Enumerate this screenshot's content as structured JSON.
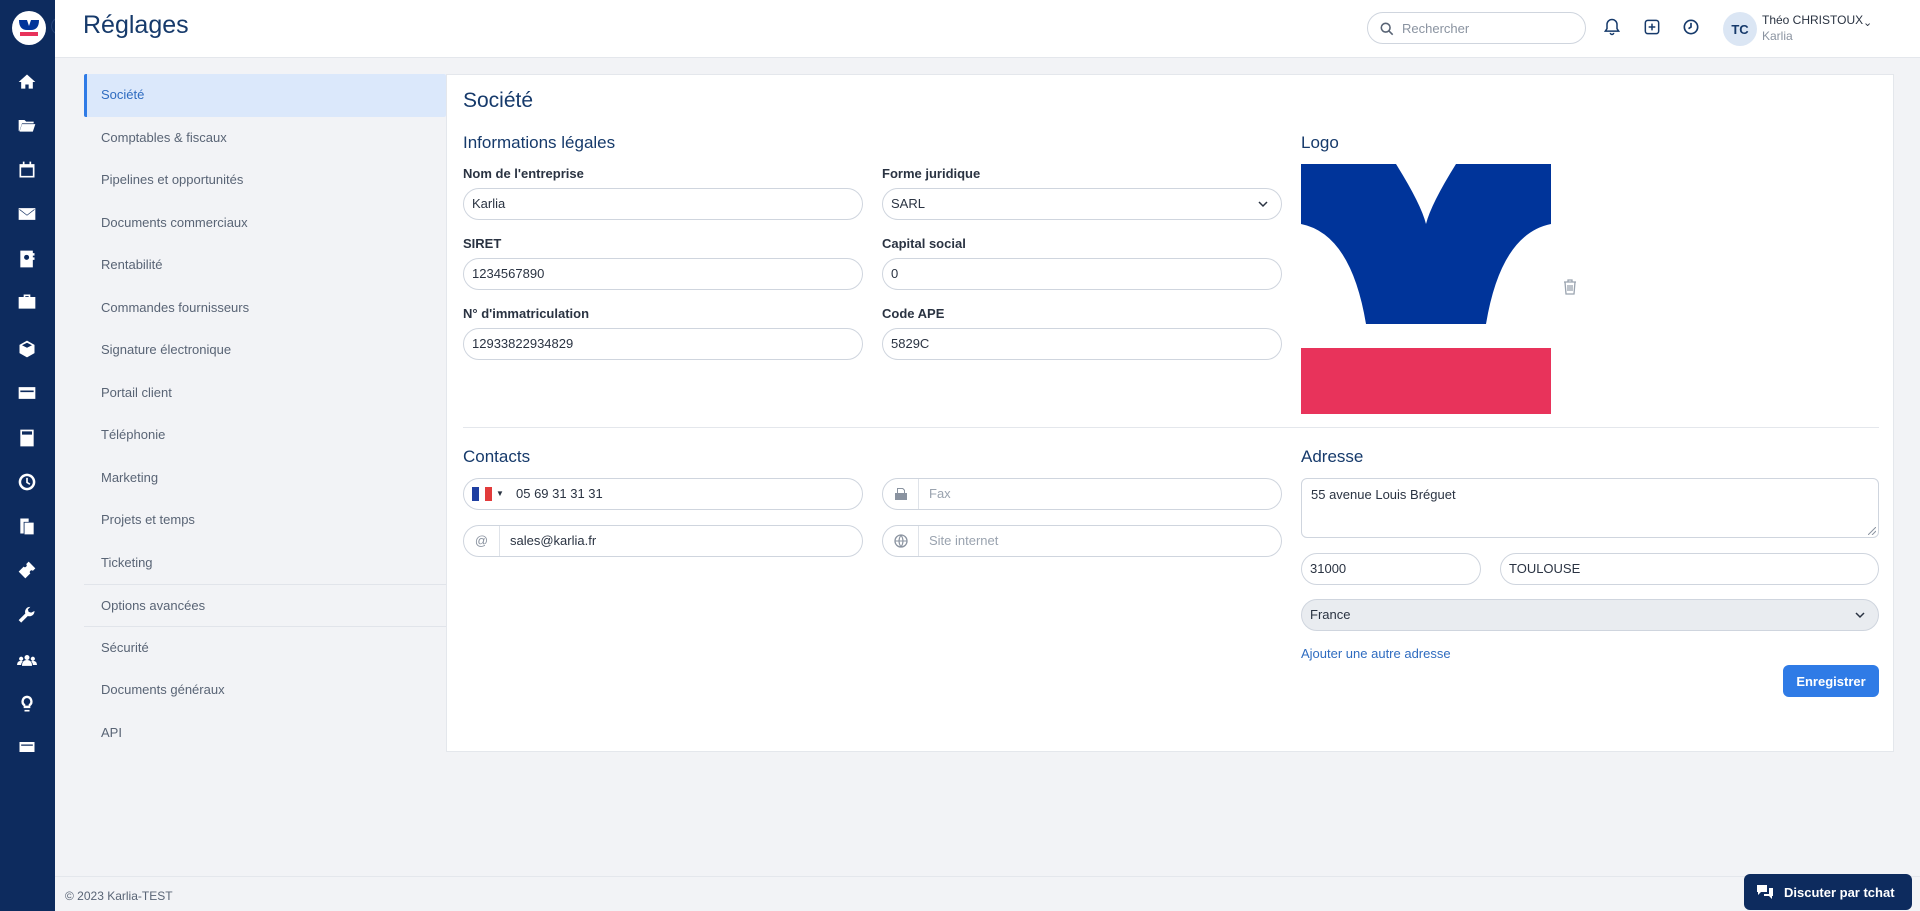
{
  "app": {
    "title": "Réglages",
    "brand_colors": {
      "primary": "#0d2b5e",
      "accent": "#2f7be6",
      "logo_blue": "#00349a",
      "logo_red": "#e8335b"
    }
  },
  "rail": {
    "icons": [
      "logo-icon",
      "home-icon",
      "folder-icon",
      "calendar-icon",
      "envelope-icon",
      "contact-card-icon",
      "briefcase-icon",
      "box-icon",
      "credit-card-icon",
      "calculator-icon",
      "clock-icon",
      "copy-icon",
      "ticket-icon",
      "wrench-icon",
      "users-icon",
      "lightbulb-icon",
      "card-icon"
    ]
  },
  "header": {
    "search_placeholder": "Rechercher",
    "user": {
      "initials": "TC",
      "name": "Théo CHRISTOUX",
      "company": "Karlia"
    },
    "help": "?"
  },
  "settings_menu": {
    "items": [
      {
        "label": "Société"
      },
      {
        "label": "Comptables & fiscaux"
      },
      {
        "label": "Pipelines et opportunités"
      },
      {
        "label": "Documents commerciaux"
      },
      {
        "label": "Rentabilité"
      },
      {
        "label": "Commandes fournisseurs"
      },
      {
        "label": "Signature électronique"
      },
      {
        "label": "Portail client"
      },
      {
        "label": "Téléphonie"
      },
      {
        "label": "Marketing"
      },
      {
        "label": "Projets et temps"
      },
      {
        "label": "Ticketing"
      },
      {
        "label": "Options avancées"
      },
      {
        "label": "Sécurité"
      },
      {
        "label": "Documents généraux"
      },
      {
        "label": "API"
      }
    ]
  },
  "panel": {
    "title": "Société",
    "legal": {
      "title": "Informations légales",
      "company_name_label": "Nom de l'entreprise",
      "company_name": "Karlia",
      "legal_form_label": "Forme juridique",
      "legal_form": "SARL",
      "siret_label": "SIRET",
      "siret": "1234567890",
      "capital_label": "Capital social",
      "capital": "0",
      "registration_label": "N° d'immatriculation",
      "registration": "12933822934829",
      "ape_label": "Code APE",
      "ape": "5829C"
    },
    "logo": {
      "title": "Logo"
    },
    "contacts": {
      "title": "Contacts",
      "phone": "05 69 31 31 31",
      "fax_placeholder": "Fax",
      "email_prefix": "@",
      "email": "sales@karlia.fr",
      "website_placeholder": "Site internet"
    },
    "address": {
      "title": "Adresse",
      "street": "55 avenue Louis Bréguet",
      "postcode": "31000",
      "city": "TOULOUSE",
      "country": "France",
      "add_address_link": "Ajouter une autre adresse"
    },
    "save_label": "Enregistrer"
  },
  "footer": {
    "copyright": "© 2023 Karlia-TEST",
    "chat_label": "Discuter par tchat"
  }
}
